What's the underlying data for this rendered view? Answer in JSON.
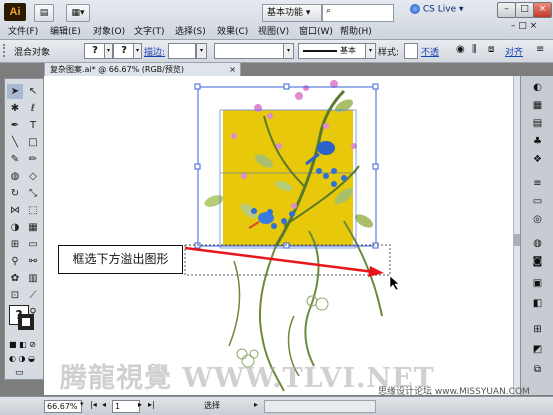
{
  "app": {
    "logo": "Ai",
    "workspace": "基本功能",
    "cs_live": "CS Live"
  },
  "menu": [
    "文件(F)",
    "编辑(E)",
    "对象(O)",
    "文字(T)",
    "选择(S)",
    "效果(C)",
    "视图(V)",
    "窗口(W)",
    "帮助(H)"
  ],
  "control_bar": {
    "object_label": "混合对象",
    "fill": "?",
    "stroke": "?",
    "stroke_label": "描边:",
    "line_style": "基本",
    "style_label": "样式:",
    "opacity_link": "不透",
    "align_link": "对齐"
  },
  "document_tab": "复杂图案.ai* @ 66.67% (RGB/预览)",
  "callout": "框选下方溢出图形",
  "status": {
    "zoom": "66.67%",
    "page": "1",
    "tool": "选择"
  },
  "watermark": "腾龍視覺 WWW.TLVI.NET",
  "watermark_site": "思缘设计论坛 www.MISSYUAN.COM",
  "colors": {
    "artboard_yellow": "#e8c80a",
    "selection_blue": "#3a63d8",
    "arrow_red": "#e8161b"
  },
  "icons": [
    "ai-logo-icon",
    "selection-tool-icon",
    "direct-selection-tool-icon",
    "pen-tool-icon",
    "type-tool-icon",
    "line-tool-icon",
    "rectangle-tool-icon",
    "brush-tool-icon",
    "pencil-tool-icon",
    "rotate-tool-icon",
    "scale-tool-icon",
    "hand-tool-icon",
    "zoom-tool-icon",
    "fill-stroke-swatch-icon"
  ]
}
